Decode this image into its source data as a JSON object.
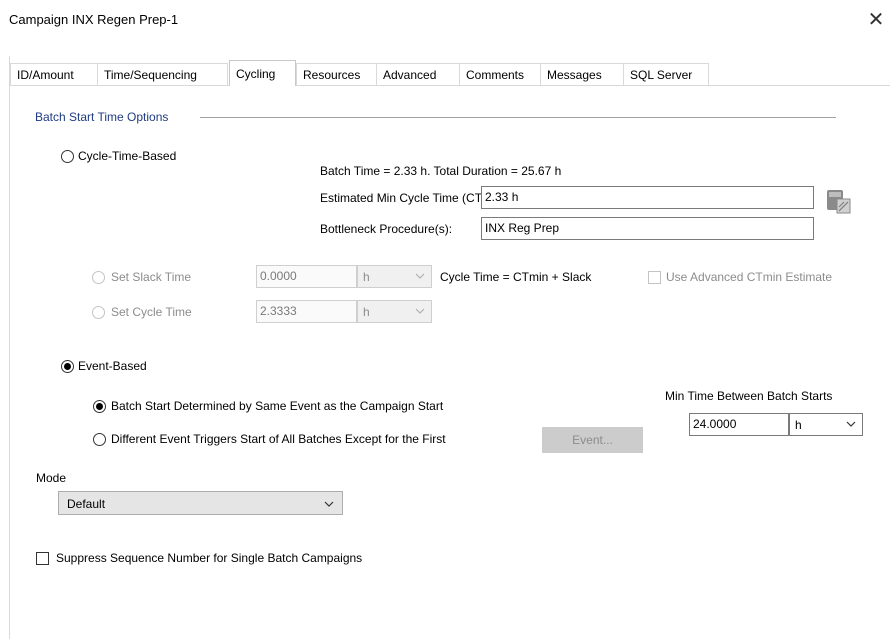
{
  "window": {
    "title": "Campaign INX Regen Prep-1"
  },
  "tabs": [
    {
      "label": "ID/Amount",
      "active": false
    },
    {
      "label": "Time/Sequencing",
      "active": false
    },
    {
      "label": "Cycling",
      "active": true
    },
    {
      "label": "Resources",
      "active": false
    },
    {
      "label": "Advanced",
      "active": false
    },
    {
      "label": "Comments",
      "active": false
    },
    {
      "label": "Messages",
      "active": false
    },
    {
      "label": "SQL Server",
      "active": false
    }
  ],
  "batch_start": {
    "group_label": "Batch Start Time Options",
    "cycle_time_based": {
      "label": "Cycle-Time-Based",
      "selected": false
    },
    "batch_time_info": "Batch Time = 2.33 h.  Total Duration = 25.67 h",
    "ctmin_label": "Estimated Min Cycle Time (CTmin) =",
    "ctmin_value": "2.33 h",
    "bottleneck_label": "Bottleneck Procedure(s):",
    "bottleneck_value": "INX Reg Prep",
    "set_slack": {
      "label": "Set Slack Time",
      "value": "0.0000",
      "unit": "h"
    },
    "cycle_time_formula": "Cycle Time = CTmin + Slack",
    "use_advanced_ctmin": {
      "label": "Use Advanced CTmin Estimate",
      "checked": false
    },
    "set_cycle": {
      "label": "Set Cycle Time",
      "value": "2.3333",
      "unit": "h"
    },
    "event_based": {
      "label": "Event-Based",
      "selected": true
    },
    "same_event": {
      "label": "Batch Start Determined by Same Event as the Campaign Start",
      "selected": true
    },
    "different_event": {
      "label": "Different Event Triggers Start of All Batches Except for the First",
      "selected": false
    },
    "event_button": "Event...",
    "min_time_label": "Min Time Between Batch Starts",
    "min_time_value": "24.0000",
    "min_time_unit": "h"
  },
  "mode": {
    "label": "Mode",
    "selected": "Default"
  },
  "suppress": {
    "label": "Suppress Sequence Number for Single Batch Campaigns",
    "checked": false
  },
  "icons": {
    "close": "close-icon",
    "calculator": "calculator-icon",
    "chevron": "chevron-down-icon"
  }
}
